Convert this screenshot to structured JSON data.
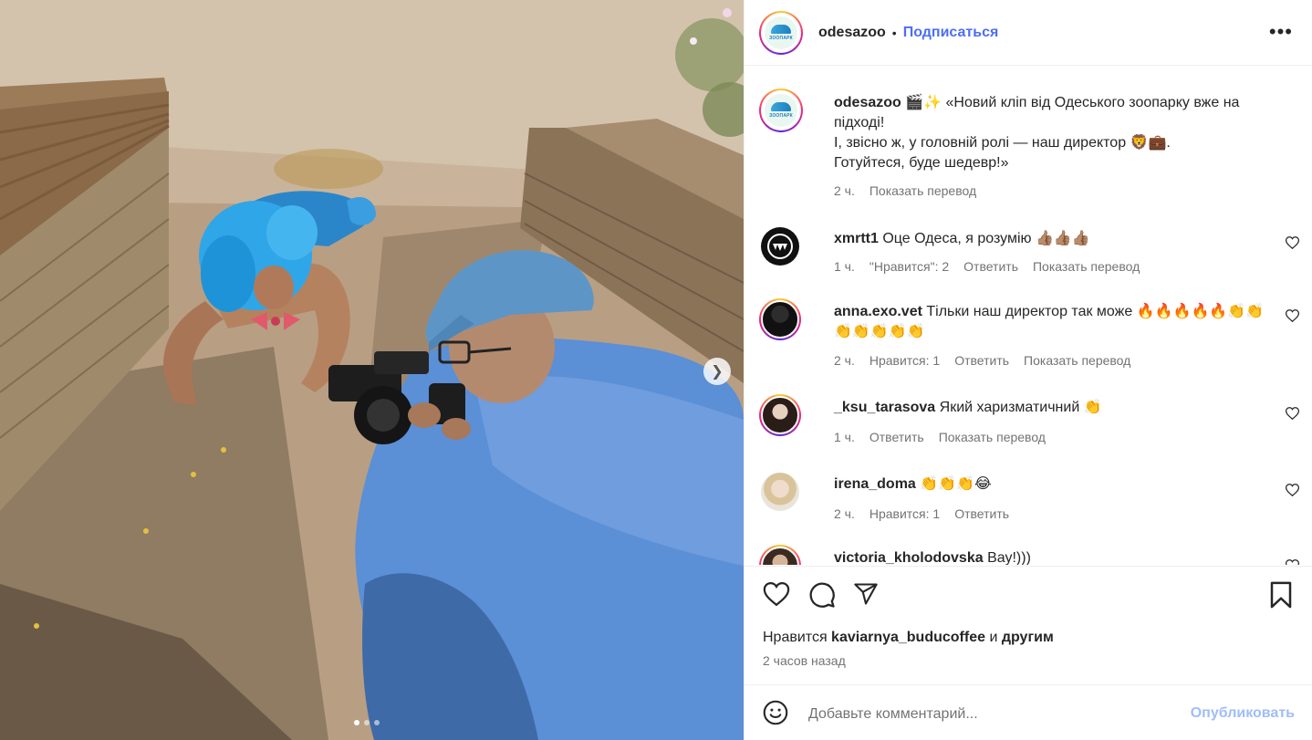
{
  "post": {
    "account": "odesazoo",
    "separator": "•",
    "follow_label": "Подписаться",
    "more_label": "•••",
    "logo_text": "ЗООПАРК"
  },
  "caption": {
    "username": "odesazoo",
    "line1": " 🎬✨ «Новий кліп від Одеського зоопарку вже на підході!",
    "line2": "І, звісно ж, у головній ролі — наш директор 🦁💼.",
    "line3": "Готуйтеся, буде шедевр!»",
    "time": "2 ч.",
    "translate": "Показать перевод"
  },
  "comments": [
    {
      "username": "xmrtt1",
      "text": " Оце Одеса, я розумію 👍🏽👍🏽👍🏽",
      "time": "1 ч.",
      "likes": "\"Нравится\": 2",
      "reply": "Ответить",
      "translate": "Показать перевод"
    },
    {
      "username": "anna.exo.vet",
      "text": " Тільки наш директор так може 🔥🔥🔥🔥🔥👏👏👏👏👏👏👏",
      "time": "2 ч.",
      "likes": "Нравится: 1",
      "reply": "Ответить",
      "translate": "Показать перевод"
    },
    {
      "username": "_ksu_tarasova",
      "text": " Який харизматичний 👏",
      "time": "1 ч.",
      "reply": "Ответить",
      "translate": "Показать перевод"
    },
    {
      "username": "irena_doma",
      "text": " 👏👏👏😂",
      "time": "2 ч.",
      "likes": "Нравится: 1",
      "reply": "Ответить"
    },
    {
      "username": "victoria_kholodovska",
      "text": " Вау!)))"
    }
  ],
  "likes_line": {
    "prefix": "Нравится ",
    "user": "kaviarnya_buducoffee",
    "mid": " и ",
    "others": "другим"
  },
  "posted_ago": "2 часов назад",
  "composer": {
    "placeholder": "Добавьте комментарий...",
    "post_label": "Опубликовать"
  },
  "carousel": {
    "slides": 3,
    "active": 1
  },
  "colors": {
    "accent": "#4c6ef5",
    "post_disabled": "#a0bdf8",
    "muted": "#737373",
    "wig": "#2fa6e8",
    "shirt": "#5b8fd6"
  },
  "icons": [
    "heart-icon",
    "comment-icon",
    "share-icon",
    "bookmark-icon",
    "emoji-icon",
    "chevron-right-icon",
    "more-icon"
  ]
}
